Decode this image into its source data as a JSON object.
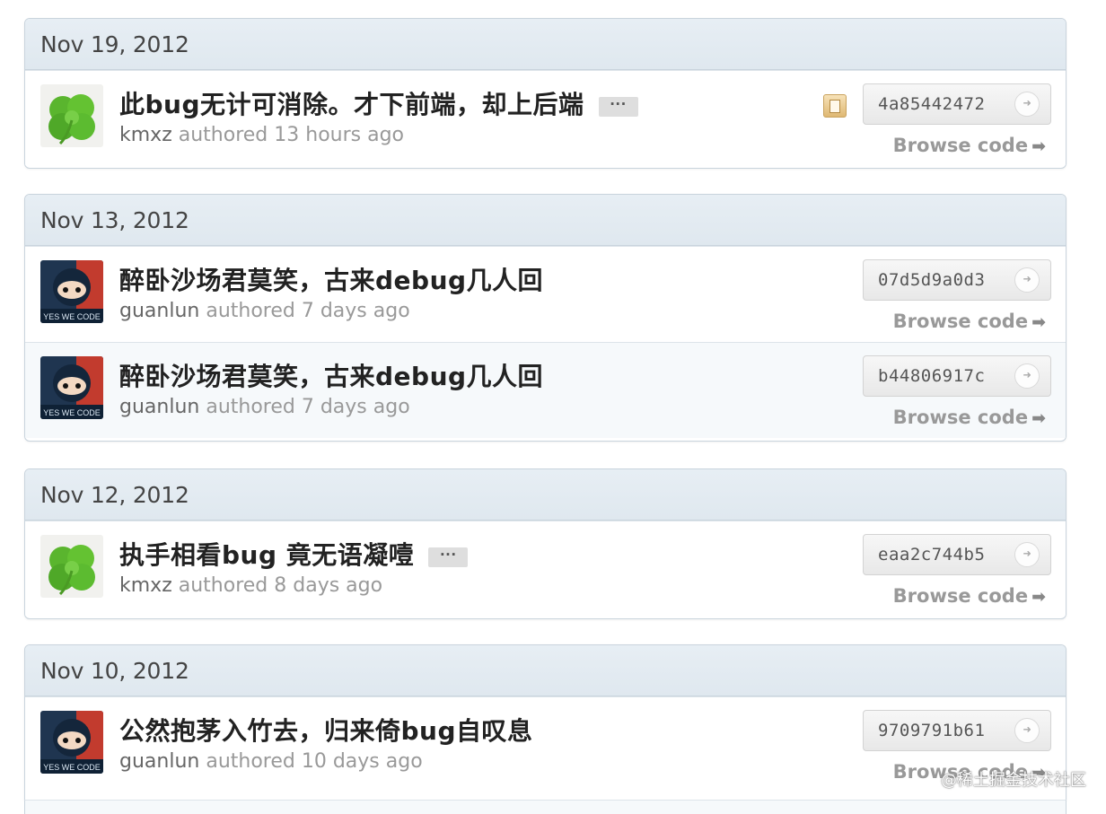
{
  "groups": [
    {
      "date": "Nov 19, 2012",
      "commits": [
        {
          "message": "此bug无计可消除。才下前端，却上后端",
          "more": "···",
          "author": "kmxz",
          "time": "authored 13 hours ago",
          "sha": "4a85442472",
          "browse": "Browse code",
          "avatar": "clover-icon"
        }
      ]
    },
    {
      "date": "Nov 13, 2012",
      "commits": [
        {
          "message": "醉卧沙场君莫笑，古来debug几人回",
          "author": "guanlun",
          "time": "authored 7 days ago",
          "sha": "07d5d9a0d3",
          "browse": "Browse code",
          "avatar": "ninja-avatar"
        },
        {
          "message": "醉卧沙场君莫笑，古来debug几人回",
          "author": "guanlun",
          "time": "authored 7 days ago",
          "sha": "b44806917c",
          "browse": "Browse code",
          "avatar": "ninja-avatar"
        }
      ]
    },
    {
      "date": "Nov 12, 2012",
      "commits": [
        {
          "message": "执手相看bug 竟无语凝噎",
          "more": "···",
          "author": "kmxz",
          "time": "authored 8 days ago",
          "sha": "eaa2c744b5",
          "browse": "Browse code",
          "avatar": "clover-icon"
        }
      ]
    },
    {
      "date": "Nov 10, 2012",
      "commits": [
        {
          "message": "公然抱茅入竹去，归来倚bug自叹息",
          "author": "guanlun",
          "time": "authored 10 days ago",
          "sha": "9709791b61",
          "browse": "Browse code",
          "avatar": "ninja-avatar"
        }
      ]
    }
  ],
  "go_glyph": "➜",
  "browse_arrow": "➡",
  "watermark": "@稀土掘金技术社区",
  "avatar_text": "YES WE CODE",
  "colors": {
    "header_bg": "#e3ebf1",
    "border": "#c9d4dd",
    "clover": "#5ab52e"
  }
}
